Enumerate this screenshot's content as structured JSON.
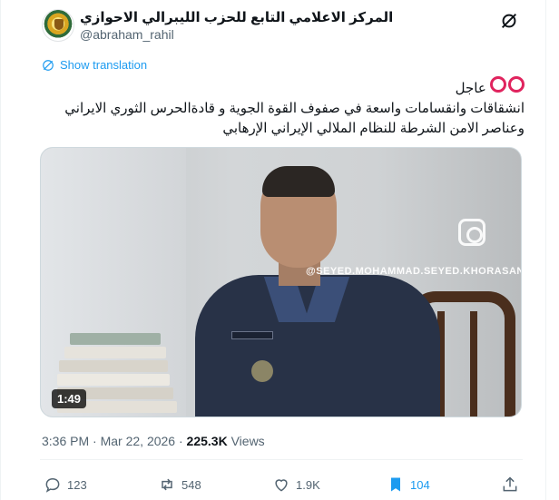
{
  "author": {
    "display_name": "المركز الاعلامي التابع للحزب الليبرالي الاحوازي",
    "handle": "@abraham_rahil"
  },
  "translation_link": "Show translation",
  "tweet": {
    "breaking_label": "عاجل",
    "line1": "انشقاقات وانقسامات واسعة في صفوف  القوة الجوية و قادةالحرس الثوري الايراني",
    "line2": "وعناصر الامن الشرطة للنظام الملالي الإيراني الإرهابي"
  },
  "media": {
    "watermark": "@SEYED.MOHAMMAD.SEYED.KHORASANI",
    "duration": "1:49"
  },
  "meta": {
    "time": "3:36 PM",
    "separator": "·",
    "date": "Mar 22, 2026",
    "views_count": "225.3K",
    "views_label": "Views"
  },
  "actions": {
    "replies": "123",
    "reposts": "548",
    "likes": "1.9K",
    "bookmarks": "104"
  },
  "colors": {
    "accent": "#1d9bf0",
    "breaking_ring": "#e0245e",
    "secondary_text": "#536471"
  }
}
